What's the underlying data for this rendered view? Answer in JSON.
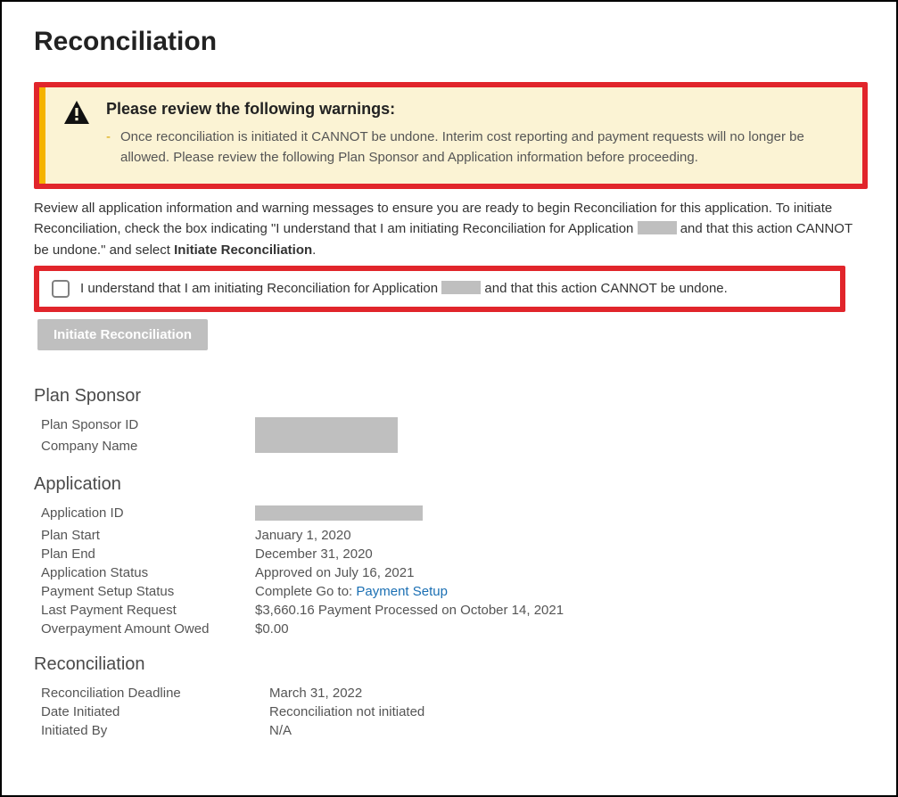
{
  "page_title": "Reconciliation",
  "warning": {
    "title": "Please review the following warnings:",
    "items": [
      "Once reconciliation is initiated it CANNOT be undone. Interim cost reporting and payment requests will no longer be allowed. Please review the following Plan Sponsor and Application information before proceeding."
    ]
  },
  "intro": {
    "part1": "Review all application information and warning messages to ensure you are ready to begin Reconciliation for this application. To initiate Reconciliation, check the box indicating \"I understand that I am initiating Reconciliation for Application ",
    "part2": " and that this action CANNOT be undone.\" and select ",
    "bold": "Initiate Reconciliation",
    "part3": "."
  },
  "consent": {
    "part1": "I understand that I am initiating Reconciliation for Application ",
    "part2": " and that this action CANNOT be undone."
  },
  "button_label": "Initiate Reconciliation",
  "sections": {
    "plan_sponsor": {
      "heading": "Plan Sponsor",
      "plan_sponsor_id_label": "Plan Sponsor ID",
      "company_name_label": "Company Name"
    },
    "application": {
      "heading": "Application",
      "application_id_label": "Application ID",
      "plan_start_label": "Plan Start",
      "plan_start_value": "January 1, 2020",
      "plan_end_label": "Plan End",
      "plan_end_value": "December 31, 2020",
      "app_status_label": "Application Status",
      "app_status_value": "Approved on July 16, 2021",
      "payment_setup_label": "Payment Setup Status",
      "payment_setup_prefix": "Complete Go to: ",
      "payment_setup_link": "Payment Setup",
      "last_payment_label": "Last Payment Request",
      "last_payment_value": "$3,660.16 Payment Processed on October 14, 2021",
      "overpayment_label": "Overpayment Amount Owed",
      "overpayment_value": "$0.00"
    },
    "reconciliation": {
      "heading": "Reconciliation",
      "deadline_label": "Reconciliation Deadline",
      "deadline_value": "March 31, 2022",
      "date_initiated_label": "Date Initiated",
      "date_initiated_value": "Reconciliation not initiated",
      "initiated_by_label": "Initiated By",
      "initiated_by_value": "N/A"
    }
  }
}
